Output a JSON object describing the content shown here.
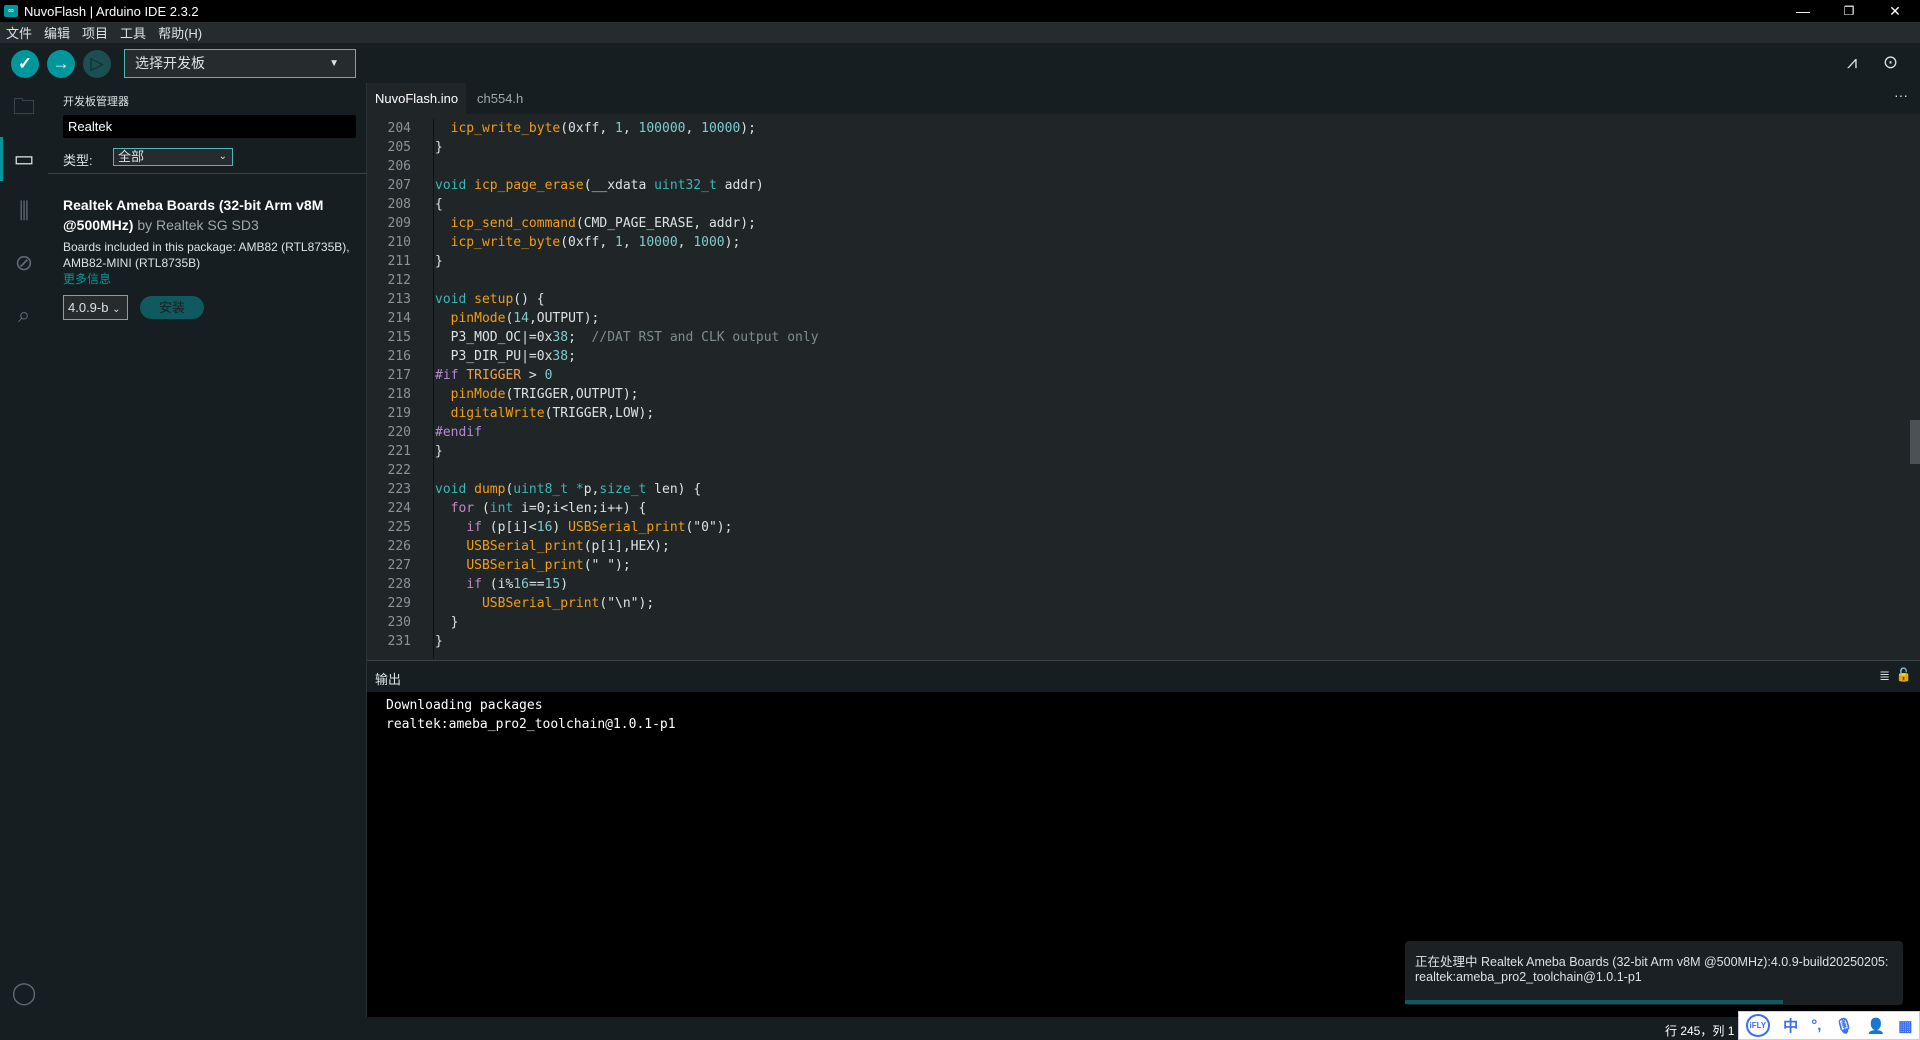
{
  "window": {
    "title": "NuvoFlash | Arduino IDE 2.3.2",
    "minimize": "—",
    "restore": "❐",
    "close": "✕"
  },
  "menu": [
    "文件",
    "编辑",
    "项目",
    "工具",
    "帮助(H)"
  ],
  "toolbar": {
    "verify": "✓",
    "upload": "→",
    "debug": "▷",
    "board_select": "选择开发板",
    "serial_plotter_icon": "⩘",
    "serial_monitor_icon": "⊙"
  },
  "sidebar": {
    "title": "开发板管理器",
    "search_value": "Realtek",
    "type_label": "类型:",
    "type_value": "全部",
    "package": {
      "name": "Realtek Ameba Boards (32-bit Arm v8M @500MHz)",
      "by": "by Realtek SG SD3",
      "description": "Boards included in this package: AMB82 (RTL8735B), AMB82-MINI (RTL8735B)",
      "more_info": "更多信息",
      "version": "4.0.9-b",
      "install": "安装"
    }
  },
  "editor": {
    "tabs": [
      {
        "label": "NuvoFlash.ino",
        "active": true
      },
      {
        "label": "ch554.h",
        "active": false
      }
    ],
    "more": "···",
    "lines": [
      {
        "n": "204",
        "t": [
          [
            "pl",
            "  "
          ],
          [
            "fn",
            "icp_write_byte"
          ],
          [
            "pl",
            "(0xff, "
          ],
          [
            "nm",
            "1"
          ],
          [
            "pl",
            ", "
          ],
          [
            "nm",
            "100000"
          ],
          [
            "pl",
            ", "
          ],
          [
            "nm",
            "10000"
          ],
          [
            "pl",
            ");"
          ]
        ]
      },
      {
        "n": "205",
        "t": [
          [
            "pl",
            "}"
          ]
        ]
      },
      {
        "n": "206",
        "t": []
      },
      {
        "n": "207",
        "t": [
          [
            "ty",
            "void"
          ],
          [
            "pl",
            " "
          ],
          [
            "fn",
            "icp_page_erase"
          ],
          [
            "pl",
            "(__xdata "
          ],
          [
            "ty",
            "uint32_t"
          ],
          [
            "pl",
            " addr)"
          ]
        ]
      },
      {
        "n": "208",
        "t": [
          [
            "pl",
            "{"
          ]
        ]
      },
      {
        "n": "209",
        "t": [
          [
            "pl",
            "  "
          ],
          [
            "fn",
            "icp_send_command"
          ],
          [
            "pl",
            "(CMD_PAGE_ERASE, addr);"
          ]
        ]
      },
      {
        "n": "210",
        "t": [
          [
            "pl",
            "  "
          ],
          [
            "fn",
            "icp_write_byte"
          ],
          [
            "pl",
            "(0xff, "
          ],
          [
            "nm",
            "1"
          ],
          [
            "pl",
            ", "
          ],
          [
            "nm",
            "10000"
          ],
          [
            "pl",
            ", "
          ],
          [
            "nm",
            "1000"
          ],
          [
            "pl",
            ");"
          ]
        ]
      },
      {
        "n": "211",
        "t": [
          [
            "pl",
            "}"
          ]
        ]
      },
      {
        "n": "212",
        "t": []
      },
      {
        "n": "213",
        "t": [
          [
            "ty",
            "void"
          ],
          [
            "pl",
            " "
          ],
          [
            "fn",
            "setup"
          ],
          [
            "pl",
            "() {"
          ]
        ]
      },
      {
        "n": "214",
        "t": [
          [
            "pl",
            "  "
          ],
          [
            "fn",
            "pinMode"
          ],
          [
            "pl",
            "("
          ],
          [
            "nm",
            "14"
          ],
          [
            "pl",
            ",OUTPUT);"
          ]
        ]
      },
      {
        "n": "215",
        "t": [
          [
            "pl",
            "  P3_MOD_OC|=0x"
          ],
          [
            "nm",
            "38"
          ],
          [
            "pl",
            ";  "
          ],
          [
            "cm",
            "//DAT RST and CLK output only"
          ]
        ]
      },
      {
        "n": "216",
        "t": [
          [
            "pl",
            "  P3_DIR_PU|=0x"
          ],
          [
            "nm",
            "38"
          ],
          [
            "pl",
            ";"
          ]
        ]
      },
      {
        "n": "217",
        "t": [
          [
            "pp",
            "#if"
          ],
          [
            "pl",
            " "
          ],
          [
            "mc",
            "TRIGGER"
          ],
          [
            "pl",
            " > "
          ],
          [
            "nm",
            "0"
          ]
        ]
      },
      {
        "n": "218",
        "t": [
          [
            "pl",
            "  "
          ],
          [
            "fn",
            "pinMode"
          ],
          [
            "pl",
            "(TRIGGER,OUTPUT);"
          ]
        ]
      },
      {
        "n": "219",
        "t": [
          [
            "pl",
            "  "
          ],
          [
            "fn",
            "digitalWrite"
          ],
          [
            "pl",
            "(TRIGGER,LOW);"
          ]
        ]
      },
      {
        "n": "220",
        "t": [
          [
            "pp",
            "#endif"
          ]
        ]
      },
      {
        "n": "221",
        "t": [
          [
            "pl",
            "}"
          ]
        ]
      },
      {
        "n": "222",
        "t": []
      },
      {
        "n": "223",
        "t": [
          [
            "ty",
            "void"
          ],
          [
            "pl",
            " "
          ],
          [
            "fn",
            "dump"
          ],
          [
            "pl",
            "("
          ],
          [
            "ty",
            "uint8_t"
          ],
          [
            "pl",
            " "
          ],
          [
            "ty",
            "*"
          ],
          [
            "pl",
            "p,"
          ],
          [
            "ty",
            "size_t"
          ],
          [
            "pl",
            " len) {"
          ]
        ]
      },
      {
        "n": "224",
        "t": [
          [
            "pl",
            "  "
          ],
          [
            "kw",
            "for"
          ],
          [
            "pl",
            " ("
          ],
          [
            "ty",
            "int"
          ],
          [
            "pl",
            " i=0;i<len;i++) {"
          ]
        ]
      },
      {
        "n": "225",
        "t": [
          [
            "pl",
            "    "
          ],
          [
            "kw",
            "if"
          ],
          [
            "pl",
            " (p[i]<"
          ],
          [
            "nm",
            "16"
          ],
          [
            "pl",
            ") "
          ],
          [
            "fn",
            "USBSerial_print"
          ],
          [
            "pl",
            "(\"0\");"
          ]
        ]
      },
      {
        "n": "226",
        "t": [
          [
            "pl",
            "    "
          ],
          [
            "fn",
            "USBSerial_print"
          ],
          [
            "pl",
            "(p[i],HEX);"
          ]
        ]
      },
      {
        "n": "227",
        "t": [
          [
            "pl",
            "    "
          ],
          [
            "fn",
            "USBSerial_print"
          ],
          [
            "pl",
            "(\" \");"
          ]
        ]
      },
      {
        "n": "228",
        "t": [
          [
            "pl",
            "    "
          ],
          [
            "kw",
            "if"
          ],
          [
            "pl",
            " (i%"
          ],
          [
            "nm",
            "16"
          ],
          [
            "pl",
            "=="
          ],
          [
            "nm",
            "15"
          ],
          [
            "pl",
            ")"
          ]
        ]
      },
      {
        "n": "229",
        "t": [
          [
            "pl",
            "      "
          ],
          [
            "fn",
            "USBSerial_print"
          ],
          [
            "pl",
            "(\"\\n\");"
          ]
        ]
      },
      {
        "n": "230",
        "t": [
          [
            "pl",
            "  }"
          ]
        ]
      },
      {
        "n": "231",
        "t": [
          [
            "pl",
            "}"
          ]
        ]
      }
    ]
  },
  "output": {
    "title": "输出",
    "lines": [
      "Downloading packages",
      "realtek:ameba_pro2_toolchain@1.0.1-p1"
    ]
  },
  "notification": {
    "text": "正在处理中 Realtek Ameba Boards (32-bit Arm v8M @500MHz):4.0.9-build20250205: realtek:ameba_pro2_toolchain@1.0.1-p1",
    "progress_percent": 76
  },
  "status": {
    "position": "行 245，列 1"
  },
  "ime": {
    "logo": "iFLY",
    "lang": "中",
    "punct": "°,",
    "mic": "🎙",
    "user": "👤",
    "apps": "▦"
  },
  "colors": {
    "accent": "#00979c",
    "editor_bg": "#202628",
    "sidebar_bg": "#171e21"
  }
}
